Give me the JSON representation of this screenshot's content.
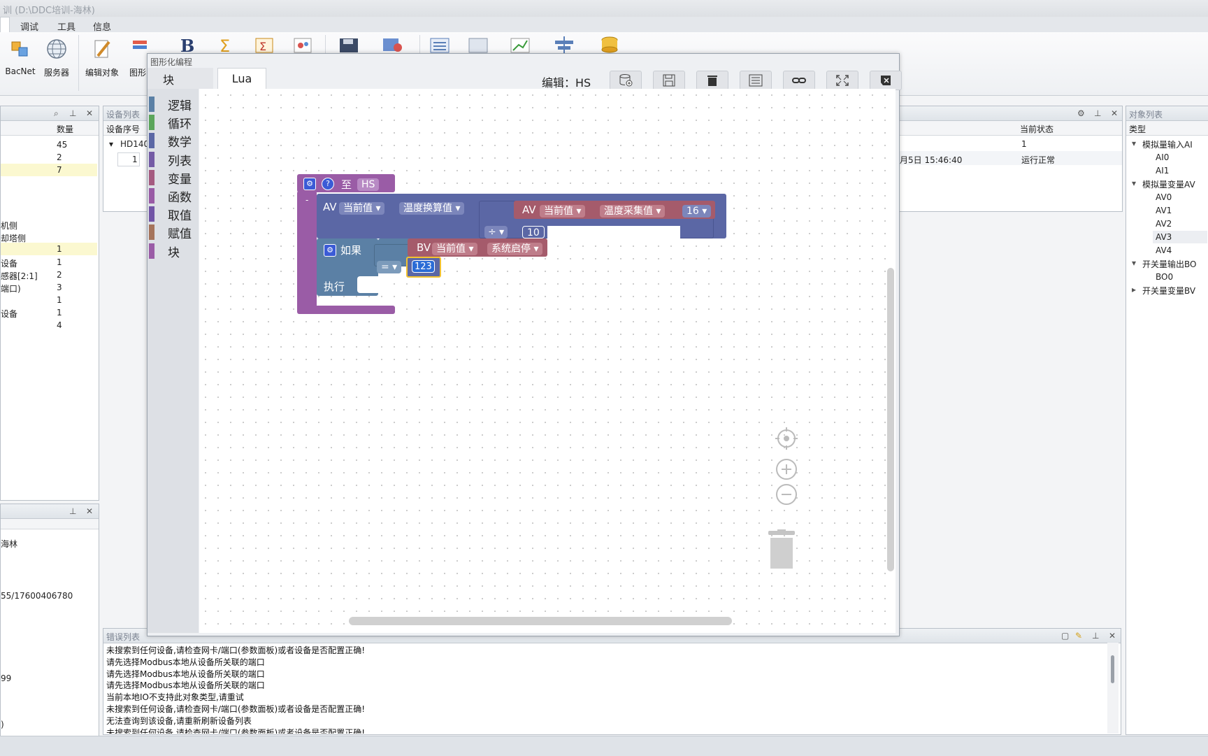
{
  "window": {
    "title": "训 (D:\\DDC培训-海林)"
  },
  "menu": {
    "items": [
      "调试",
      "工具",
      "信息"
    ]
  },
  "ribbon": {
    "buttons": [
      {
        "label": "BacNet",
        "icon": "bacnet-icon"
      },
      {
        "label": "服务器",
        "icon": "globe-icon"
      },
      {
        "label": "编辑对象",
        "icon": "edit-icon"
      },
      {
        "label": "图形",
        "icon": "graph-icon"
      }
    ]
  },
  "left_panel": {
    "header": "数量",
    "rows": [
      {
        "name": "",
        "value": "45"
      },
      {
        "name": "",
        "value": "2"
      },
      {
        "name": "",
        "value": "7"
      },
      {
        "name": "机侧",
        "value": ""
      },
      {
        "name": "却塔侧",
        "value": ""
      },
      {
        "name": "",
        "value": "1"
      },
      {
        "name": "设备",
        "value": "1"
      },
      {
        "name": "感器[2:1]",
        "value": "2"
      },
      {
        "name": "端口)",
        "value": "3"
      },
      {
        "name": "",
        "value": "1"
      },
      {
        "name": "设备",
        "value": "1"
      },
      {
        "name": "",
        "value": "4"
      }
    ]
  },
  "left_bottom_panel": {
    "lines": [
      "海林",
      "55/17600406780",
      "99",
      ")"
    ]
  },
  "device_panel": {
    "title": "设备列表",
    "col": "设备序号",
    "items": [
      "HD140",
      "1"
    ]
  },
  "right_panel": {
    "col_state": "当前状态",
    "rows": [
      {
        "time": "",
        "state": "1"
      },
      {
        "time": "月5日 15:46:40",
        "state": "运行正常"
      }
    ]
  },
  "object_panel": {
    "title": "对象列表",
    "col": "类型",
    "tree": [
      {
        "label": "模拟量输入AI",
        "children": [
          "AI0",
          "AI1"
        ]
      },
      {
        "label": "模拟量变量AV",
        "children": [
          "AV0",
          "AV1",
          "AV2",
          "AV3",
          "AV4"
        ]
      },
      {
        "label": "开关量输出BO",
        "children": [
          "BO0"
        ]
      },
      {
        "label": "开关量变量BV",
        "children": []
      }
    ]
  },
  "dialog": {
    "title": "图形化编程",
    "tab_block": "块",
    "tab_lua": "Lua",
    "edit_label": "编辑：HS",
    "toolbox": [
      {
        "label": "逻辑",
        "color": "#5b80a5"
      },
      {
        "label": "循环",
        "color": "#5ba55b"
      },
      {
        "label": "数学",
        "color": "#5b67a5"
      },
      {
        "label": "列表",
        "color": "#745ba5"
      },
      {
        "label": "变量",
        "color": "#a55b80"
      },
      {
        "label": "函数",
        "color": "#995ba5"
      },
      {
        "label": "取值",
        "color": "#7255a6"
      },
      {
        "label": "赋值",
        "color": "#a5745b"
      },
      {
        "label": "块",
        "color": "#9a5ca6"
      }
    ],
    "blocks": {
      "func": {
        "label": "至",
        "name": "HS"
      },
      "set_av": {
        "prefix": "AV",
        "prop": "当前值",
        "target": "温度换算值"
      },
      "get_av": {
        "prefix": "AV",
        "prop": "当前值",
        "target": "温度采集值",
        "num": "16"
      },
      "op": "÷",
      "divisor": "10",
      "if": {
        "label": "如果",
        "cmp": "=",
        "bv": "BV",
        "prop": "当前值",
        "target": "系统启停",
        "value": "123"
      },
      "do": "执行"
    }
  },
  "error_panel": {
    "title": "错误列表",
    "lines": [
      "未搜索到任何设备,请检查网卡/端口(参数面板)或者设备是否配置正确!",
      "请先选择Modbus本地从设备所关联的端口",
      "请先选择Modbus本地从设备所关联的端口",
      "请先选择Modbus本地从设备所关联的端口",
      "当前本地IO不支持此对象类型,请重试",
      "未搜索到任何设备,请检查网卡/端口(参数面板)或者设备是否配置正确!",
      "无法查询到该设备,请重新刷新设备列表",
      "未搜索到任何设备,请检查网卡/端口(参数面板)或者设备是否配置正确!"
    ]
  },
  "colors": {
    "av_block": "#5b67a5",
    "bv_block": "#a55b6b",
    "func_block": "#9a5ca6",
    "logic_block": "#5b80a5"
  }
}
